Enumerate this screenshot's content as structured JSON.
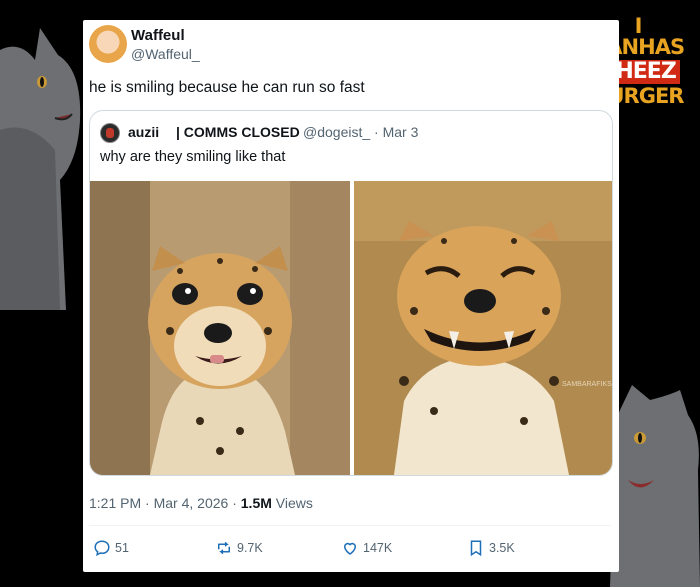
{
  "brand": {
    "line1": "I CANHAS",
    "line2": "CHEEZ",
    "line3": "BURGER"
  },
  "tweet": {
    "author_name": "Waffeul",
    "author_handle": "@Waffeul_",
    "text": "he is smiling because he can run so fast",
    "time": "1:21 PM",
    "date": "Mar 4, 2026",
    "views_count": "1.5M",
    "views_label": "Views"
  },
  "quote": {
    "author_name": "auzii",
    "author_status": "| COMMS CLOSED",
    "author_handle": "@dogeist_ · Mar 3",
    "text": "why are they smiling like that",
    "photo_watermark": "SAMBARAFIKS"
  },
  "actions": {
    "replies": "51",
    "reposts": "9.7K",
    "likes": "147K",
    "bookmarks": "3.5K"
  },
  "icons": [
    "reply-icon",
    "repost-icon",
    "like-icon",
    "bookmark-icon"
  ]
}
